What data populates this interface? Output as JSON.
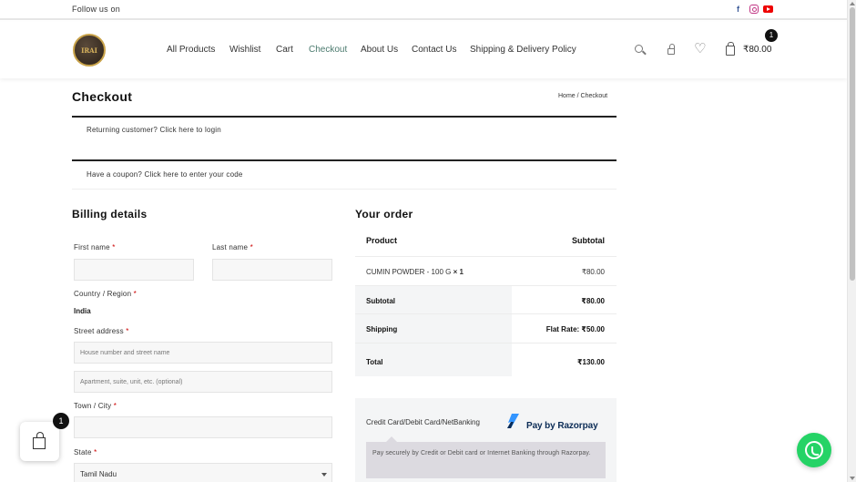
{
  "topbar": {
    "follow_text": "Follow us on",
    "social": [
      "facebook-icon",
      "instagram-icon",
      "youtube-icon"
    ]
  },
  "header": {
    "logo_text": "IRAI",
    "nav": [
      "All Products",
      "Wishlist",
      "Cart",
      "Checkout",
      "About Us",
      "Contact Us",
      "Shipping & Delivery Policy"
    ],
    "active_nav": "Checkout",
    "cart_total": "₹80.00",
    "cart_count": "1",
    "accent_color": "#4b7a6e"
  },
  "page": {
    "title": "Checkout",
    "breadcrumb_home": "Home",
    "breadcrumb_sep": "/",
    "breadcrumb_current": "Checkout"
  },
  "notices": {
    "login": "Returning customer? Click here to login",
    "coupon": "Have a coupon? Click here to enter your code"
  },
  "billing": {
    "title": "Billing details",
    "first_name_label": "First name",
    "last_name_label": "Last name",
    "country_label": "Country / Region",
    "country_value": "India",
    "street_label": "Street address",
    "street_placeholder": "House number and street name",
    "apartment_placeholder": "Apartment, suite, unit, etc. (optional)",
    "city_label": "Town / City",
    "state_label": "State",
    "state_value": "Tamil Nadu",
    "required_mark": "*"
  },
  "order": {
    "title": "Your order",
    "col_product": "Product",
    "col_subtotal": "Subtotal",
    "item_name": "CUMIN POWDER - 100 G",
    "item_qty": "× 1",
    "item_price": "₹80.00",
    "subtotal_label": "Subtotal",
    "subtotal_value": "₹80.00",
    "shipping_label": "Shipping",
    "shipping_value": "Flat Rate: ₹50.00",
    "total_label": "Total",
    "total_value": "₹130.00"
  },
  "payment": {
    "method_label": "Credit Card/Debit Card/NetBanking",
    "brand": "Pay by Razorpay",
    "description": "Pay securely by Credit or Debit card or Internet Banking through Razorpay."
  },
  "floating": {
    "cart_count": "1"
  }
}
